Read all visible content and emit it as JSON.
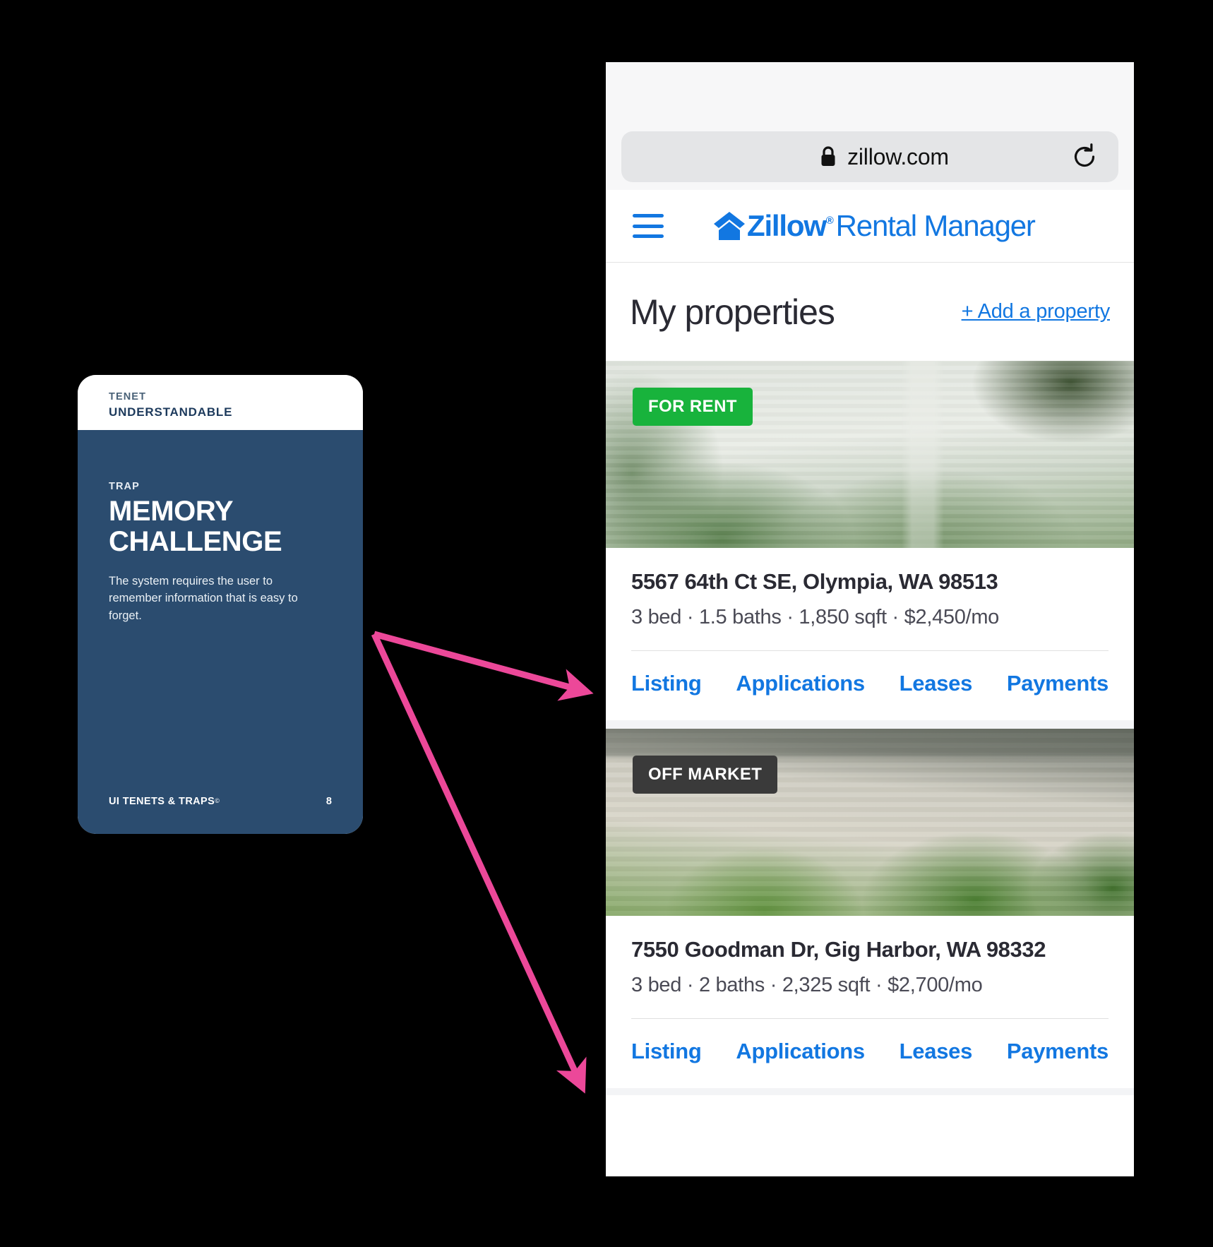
{
  "tenet_card": {
    "tenet_kicker": "TENET",
    "tenet_name": "UNDERSTANDABLE",
    "trap_kicker": "TRAP",
    "trap_title": "MEMORY CHALLENGE",
    "trap_description": "The system requires the user to remember information that is easy to forget.",
    "footer_brand": "UI TENETS & TRAPS",
    "footer_copyright": "©",
    "page_number": "8",
    "colors": {
      "card_navy": "#2b4c6f",
      "kicker_blue": "#4a6278",
      "tenet_name_blue": "#1d3a5c"
    }
  },
  "browser": {
    "url": "zillow.com",
    "lock_icon": "lock-icon",
    "reload_icon": "reload-icon"
  },
  "app_header": {
    "menu_icon": "hamburger-menu-icon",
    "logo_mark": "zillow-house-icon",
    "logo_brand": "Zillow",
    "logo_registered": "®",
    "logo_suffix": "Rental Manager",
    "brand_color": "#1277e1"
  },
  "page": {
    "title": "My properties",
    "add_property_label": "+ Add a property"
  },
  "properties": [
    {
      "badge": "FOR RENT",
      "badge_color": "#18b33c",
      "address": "5567 64th Ct SE, Olympia, WA 98513",
      "details": "3 bed · 1.5 baths · 1,850 sqft · $2,450/mo",
      "links": [
        "Listing",
        "Applications",
        "Leases",
        "Payments"
      ]
    },
    {
      "badge": "OFF MARKET",
      "badge_color": "#3a3a3a",
      "address": "7550 Goodman Dr, Gig Harbor, WA 98332",
      "details": "3 bed · 2 baths · 2,325 sqft · $2,700/mo",
      "links": [
        "Listing",
        "Applications",
        "Leases",
        "Payments"
      ]
    }
  ],
  "annotations": {
    "arrow_color": "#ec4899",
    "arrow_count": 2,
    "arrow_targets": [
      "property-1-links-row",
      "property-2-links-row"
    ]
  }
}
